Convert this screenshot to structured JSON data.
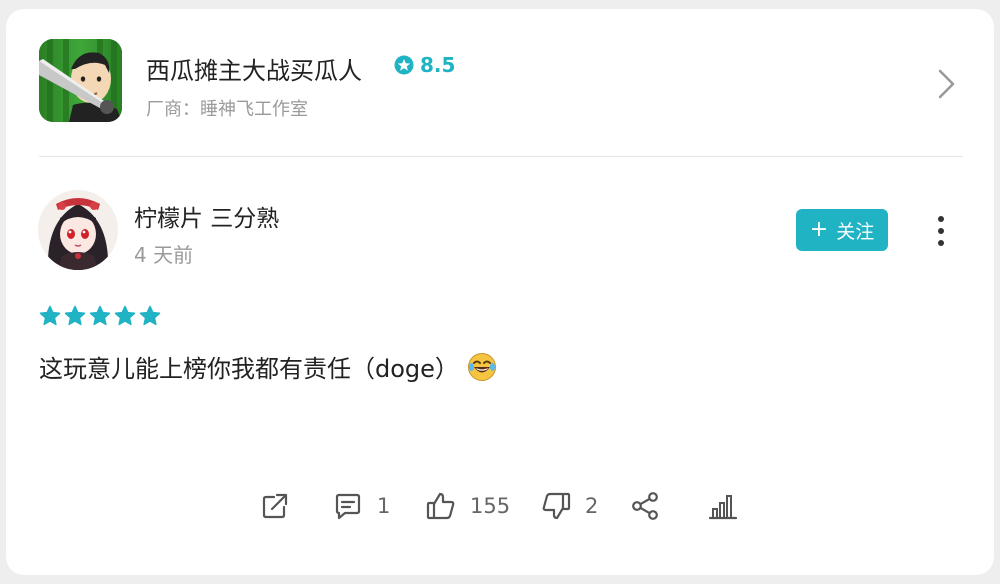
{
  "app": {
    "name": "西瓜摊主大战买瓜人",
    "rating": "8.5",
    "developer": "厂商：睡神飞工作室",
    "icon": "app-icon",
    "rating_icon": "star-badge-icon"
  },
  "review": {
    "username": "柠檬片 三分熟",
    "time": "4 天前",
    "follow_label": "关注",
    "stars": 5,
    "text": "这玩意儿能上榜你我都有责任（doge）",
    "emoji": "laughing-crying-emoji"
  },
  "actions": {
    "comments": "1",
    "likes": "155",
    "dislikes": "2"
  },
  "colors": {
    "accent": "#1fb3c4",
    "secondary_text": "#9a9a9a"
  }
}
